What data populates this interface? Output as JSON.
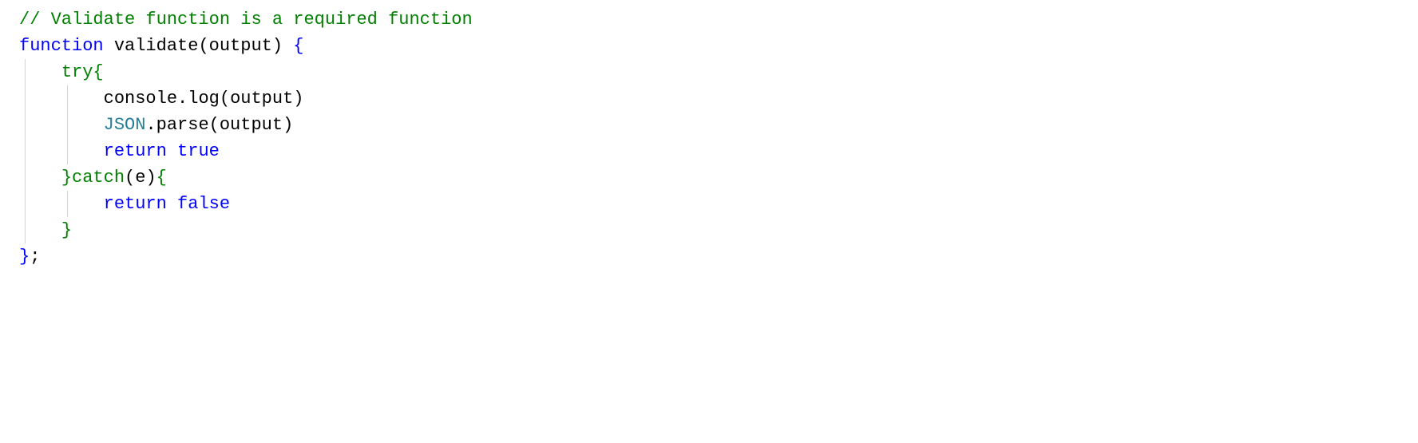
{
  "code": {
    "line1": {
      "comment": "// Validate function is a required function"
    },
    "line2": {
      "kw_function": "function",
      "sp1": " ",
      "fn_name": "validate",
      "lparen": "(",
      "param": "output",
      "rparen": ")",
      "sp2": " ",
      "lbrace": "{"
    },
    "line3": {
      "indent": "    ",
      "kw_try": "try",
      "lbrace": "{"
    },
    "line4": {
      "indent": "        ",
      "obj": "console",
      "dot": ".",
      "method": "log",
      "lparen": "(",
      "arg": "output",
      "rparen": ")"
    },
    "line5": {
      "indent": "        ",
      "cls": "JSON",
      "dot": ".",
      "method": "parse",
      "lparen": "(",
      "arg": "output",
      "rparen": ")"
    },
    "line6": {
      "indent": "        ",
      "kw_return": "return",
      "sp": " ",
      "val": "true"
    },
    "line7": {
      "indent": "    ",
      "rbrace": "}",
      "kw_catch": "catch",
      "lparen": "(",
      "param": "e",
      "rparen": ")",
      "lbrace": "{"
    },
    "line8": {
      "indent": "        ",
      "kw_return": "return",
      "sp": " ",
      "val": "false"
    },
    "line9": {
      "indent": "    ",
      "rbrace": "}"
    },
    "line10": {
      "rbrace": "}",
      "semi": ";"
    }
  }
}
